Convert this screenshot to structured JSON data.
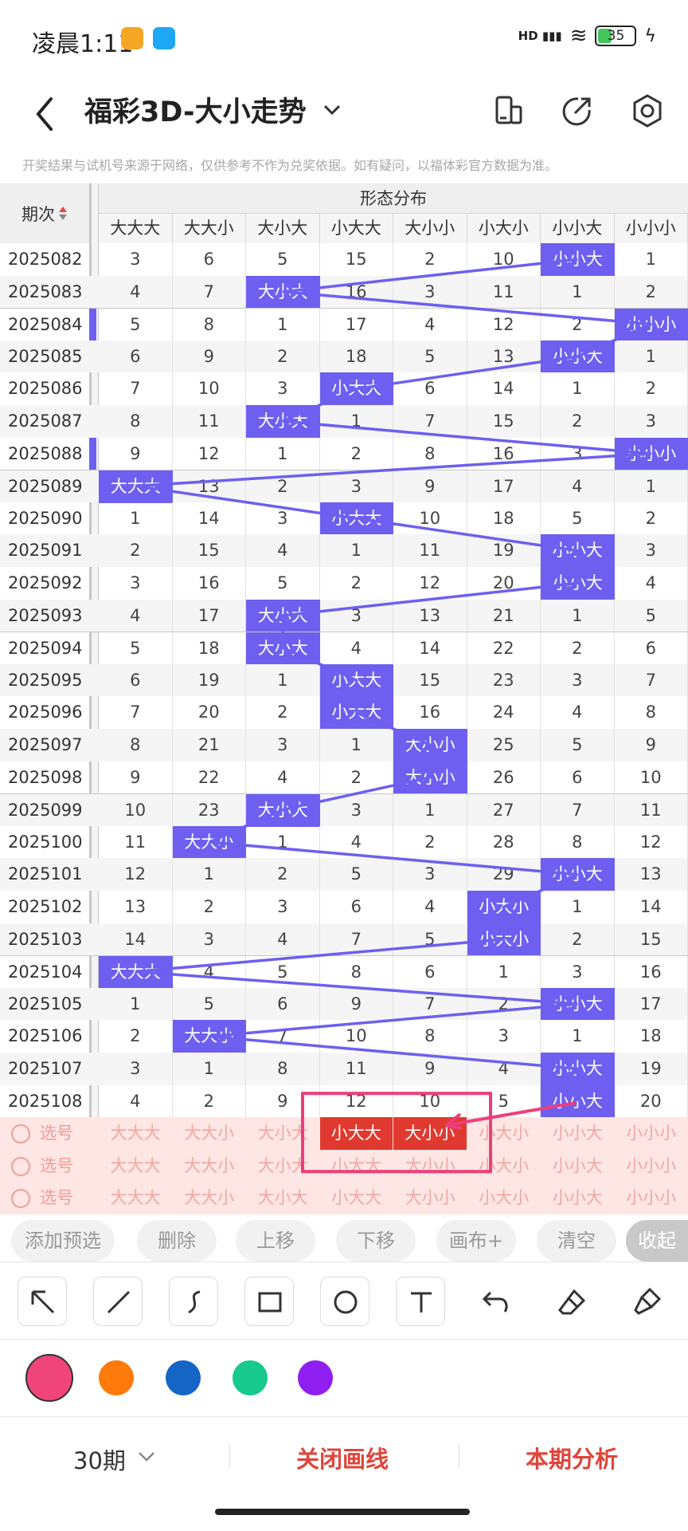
{
  "status": {
    "time": "凌晨1:11",
    "net": "HD",
    "battery": "35"
  },
  "nav": {
    "title": "福彩3D-大小走势"
  },
  "disclaimer": "开奖结果与试机号来源于网络，仅供参考不作为兑奖依据。如有疑问，以福体彩官方数据为准。",
  "chart_data": {
    "type": "table",
    "group_title": "形态分布",
    "period_header": "期次",
    "columns": [
      "大大大",
      "大大小",
      "大小大",
      "小大大",
      "大小小",
      "小大小",
      "小小大",
      "小小小"
    ],
    "rows": [
      {
        "qi": "2025082",
        "cells": [
          "3",
          "6",
          "5",
          "15",
          "2",
          "10",
          "小小大",
          "1"
        ],
        "hit": 6
      },
      {
        "qi": "2025083",
        "cells": [
          "4",
          "7",
          "大小大",
          "16",
          "3",
          "11",
          "1",
          "2"
        ],
        "hit": 2
      },
      {
        "qi": "2025084",
        "cells": [
          "5",
          "8",
          "1",
          "17",
          "4",
          "12",
          "2",
          "小小小"
        ],
        "hit": 7
      },
      {
        "qi": "2025085",
        "cells": [
          "6",
          "9",
          "2",
          "18",
          "5",
          "13",
          "小小大",
          "1"
        ],
        "hit": 6
      },
      {
        "qi": "2025086",
        "cells": [
          "7",
          "10",
          "3",
          "小大大",
          "6",
          "14",
          "1",
          "2"
        ],
        "hit": 3
      },
      {
        "qi": "2025087",
        "cells": [
          "8",
          "11",
          "大小大",
          "1",
          "7",
          "15",
          "2",
          "3"
        ],
        "hit": 2
      },
      {
        "qi": "2025088",
        "cells": [
          "9",
          "12",
          "1",
          "2",
          "8",
          "16",
          "3",
          "小小小"
        ],
        "hit": 7
      },
      {
        "qi": "2025089",
        "cells": [
          "大大大",
          "13",
          "2",
          "3",
          "9",
          "17",
          "4",
          "1"
        ],
        "hit": 0
      },
      {
        "qi": "2025090",
        "cells": [
          "1",
          "14",
          "3",
          "小大大",
          "10",
          "18",
          "5",
          "2"
        ],
        "hit": 3
      },
      {
        "qi": "2025091",
        "cells": [
          "2",
          "15",
          "4",
          "1",
          "11",
          "19",
          "小小大",
          "3"
        ],
        "hit": 6
      },
      {
        "qi": "2025092",
        "cells": [
          "3",
          "16",
          "5",
          "2",
          "12",
          "20",
          "小小大",
          "4"
        ],
        "hit": 6
      },
      {
        "qi": "2025093",
        "cells": [
          "4",
          "17",
          "大小大",
          "3",
          "13",
          "21",
          "1",
          "5"
        ],
        "hit": 2
      },
      {
        "qi": "2025094",
        "cells": [
          "5",
          "18",
          "大小大",
          "4",
          "14",
          "22",
          "2",
          "6"
        ],
        "hit": 2
      },
      {
        "qi": "2025095",
        "cells": [
          "6",
          "19",
          "1",
          "小大大",
          "15",
          "23",
          "3",
          "7"
        ],
        "hit": 3
      },
      {
        "qi": "2025096",
        "cells": [
          "7",
          "20",
          "2",
          "小大大",
          "16",
          "24",
          "4",
          "8"
        ],
        "hit": 3
      },
      {
        "qi": "2025097",
        "cells": [
          "8",
          "21",
          "3",
          "1",
          "大小小",
          "25",
          "5",
          "9"
        ],
        "hit": 4
      },
      {
        "qi": "2025098",
        "cells": [
          "9",
          "22",
          "4",
          "2",
          "大小小",
          "26",
          "6",
          "10"
        ],
        "hit": 4
      },
      {
        "qi": "2025099",
        "cells": [
          "10",
          "23",
          "大小大",
          "3",
          "1",
          "27",
          "7",
          "11"
        ],
        "hit": 2
      },
      {
        "qi": "2025100",
        "cells": [
          "11",
          "大大小",
          "1",
          "4",
          "2",
          "28",
          "8",
          "12"
        ],
        "hit": 1
      },
      {
        "qi": "2025101",
        "cells": [
          "12",
          "1",
          "2",
          "5",
          "3",
          "29",
          "小小大",
          "13"
        ],
        "hit": 6
      },
      {
        "qi": "2025102",
        "cells": [
          "13",
          "2",
          "3",
          "6",
          "4",
          "小大小",
          "1",
          "14"
        ],
        "hit": 5
      },
      {
        "qi": "2025103",
        "cells": [
          "14",
          "3",
          "4",
          "7",
          "5",
          "小大小",
          "2",
          "15"
        ],
        "hit": 5
      },
      {
        "qi": "2025104",
        "cells": [
          "大大大",
          "4",
          "5",
          "8",
          "6",
          "1",
          "3",
          "16"
        ],
        "hit": 0
      },
      {
        "qi": "2025105",
        "cells": [
          "1",
          "5",
          "6",
          "9",
          "7",
          "2",
          "小小大",
          "17"
        ],
        "hit": 6
      },
      {
        "qi": "2025106",
        "cells": [
          "2",
          "大大小",
          "7",
          "10",
          "8",
          "3",
          "1",
          "18"
        ],
        "hit": 1
      },
      {
        "qi": "2025107",
        "cells": [
          "3",
          "1",
          "8",
          "11",
          "9",
          "4",
          "小小大",
          "19"
        ],
        "hit": 6
      },
      {
        "qi": "2025108",
        "cells": [
          "4",
          "2",
          "9",
          "12",
          "10",
          "5",
          "小小大",
          "20"
        ],
        "hit": 6
      }
    ],
    "select_rows": [
      {
        "label": "选号",
        "selected": [
          3,
          4
        ]
      },
      {
        "label": "选号",
        "selected": []
      },
      {
        "label": "选号",
        "selected": []
      }
    ]
  },
  "actions": [
    "添加预选",
    "删除",
    "上移",
    "下移",
    "画布+",
    "清空",
    "收起"
  ],
  "tools": [
    "arrow-tool",
    "line-tool",
    "curve-tool",
    "rect-tool",
    "circle-tool",
    "text-tool",
    "undo-tool",
    "eraser-tool",
    "clear-tool"
  ],
  "colors": [
    "#f0457a",
    "#ff7a0a",
    "#1565c6",
    "#17c98c",
    "#8f1ff0"
  ],
  "footer": {
    "period": "30期",
    "close": "关闭画线",
    "analyze": "本期分析"
  }
}
